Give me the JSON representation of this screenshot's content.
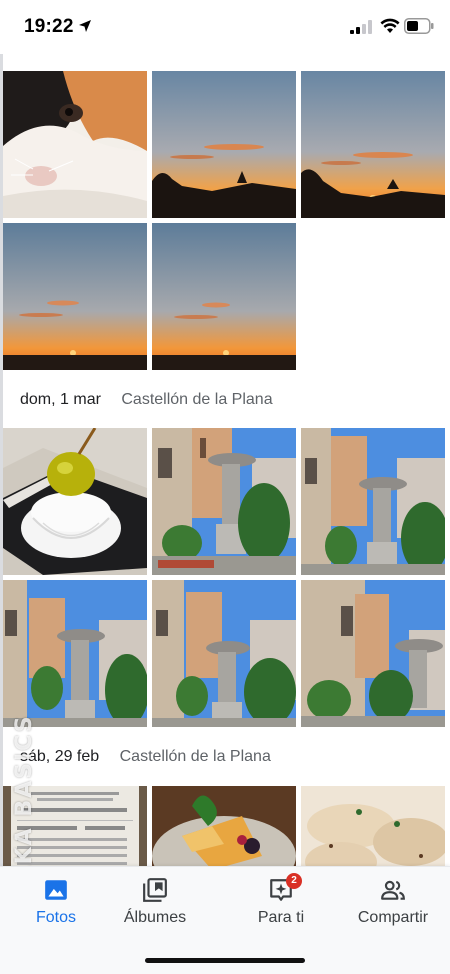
{
  "status_bar": {
    "time": "19:22",
    "icons": [
      "location-arrow-icon",
      "cellular-signal-icon",
      "wifi-icon",
      "battery-icon"
    ]
  },
  "sections": [
    {
      "date": "dom, 1 mar",
      "place": "Castellón de la Plana"
    },
    {
      "date": "sáb, 29 feb",
      "place": "Castellón de la Plana"
    }
  ],
  "watermark": "XATAKA BASICS",
  "bottom_nav": {
    "items": [
      {
        "label": "Fotos",
        "icon": "photo-icon",
        "active": true
      },
      {
        "label": "Álbumes",
        "icon": "albums-icon",
        "active": false
      },
      {
        "label": "Para ti",
        "icon": "for-you-icon",
        "active": false,
        "badge": "2"
      },
      {
        "label": "Compartir",
        "icon": "share-people-icon",
        "active": false
      }
    ]
  },
  "colors": {
    "accent": "#1a73e8",
    "badge": "#d93025",
    "sunset_sky_top": "#5f7f9f",
    "sunset_glow": "#f39c3a"
  }
}
